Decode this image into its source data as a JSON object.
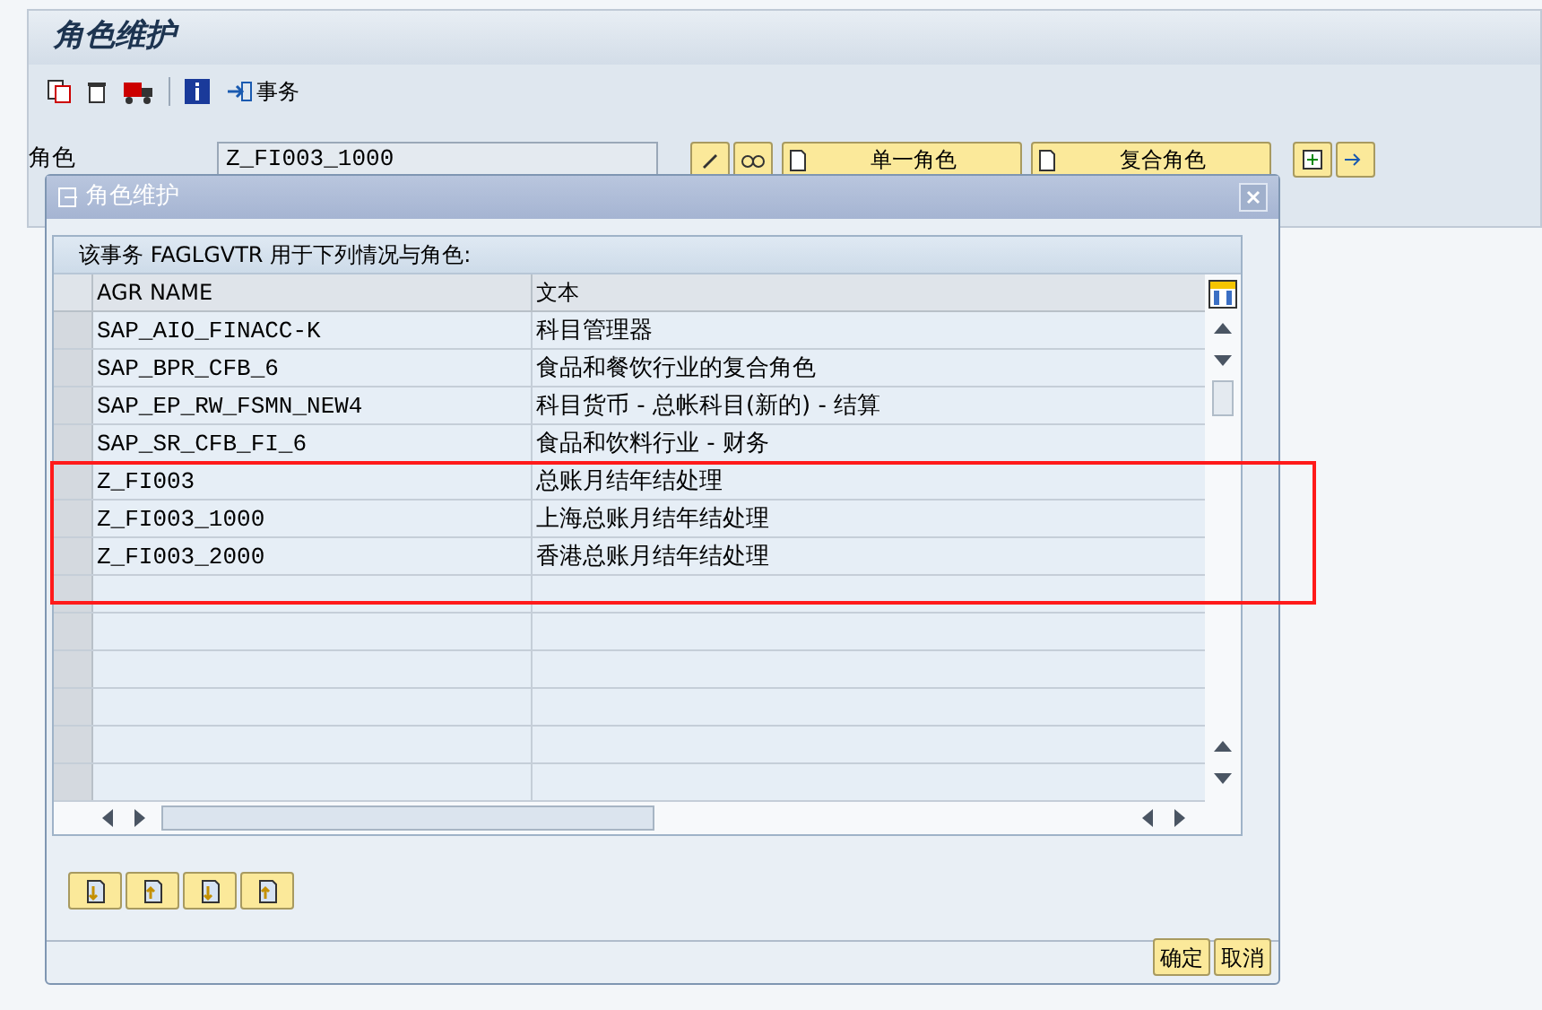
{
  "window": {
    "title": "角色维护"
  },
  "toolbar": {
    "transaction_label": "事务"
  },
  "role_field": {
    "label": "角色",
    "value": "Z_FI003_1000"
  },
  "role_buttons": [
    "单一角色",
    "复合角色"
  ],
  "dialog": {
    "title": "角色维护",
    "caption": "该事务 FAGLGVTR 用于下列情况与角色:",
    "columns": [
      "AGR NAME",
      "文本"
    ],
    "rows": [
      {
        "name": "SAP_AIO_FINACC-K",
        "text": "科目管理器",
        "highlighted": false
      },
      {
        "name": "SAP_BPR_CFB_6",
        "text": "食品和餐饮行业的复合角色",
        "highlighted": false
      },
      {
        "name": "SAP_EP_RW_FSMN_NEW4",
        "text": "科目货币 - 总帐科目(新的) - 结算",
        "highlighted": false
      },
      {
        "name": "SAP_SR_CFB_FI_6",
        "text": "食品和饮料行业 - 财务",
        "highlighted": false
      },
      {
        "name": "Z_FI003",
        "text": "总账月结年结处理",
        "highlighted": true
      },
      {
        "name": "Z_FI003_1000",
        "text": "上海总账月结年结处理",
        "highlighted": true
      },
      {
        "name": "Z_FI003_2000",
        "text": "香港总账月结年结处理",
        "highlighted": true
      }
    ],
    "buttons": [
      "确定",
      "取消"
    ]
  }
}
